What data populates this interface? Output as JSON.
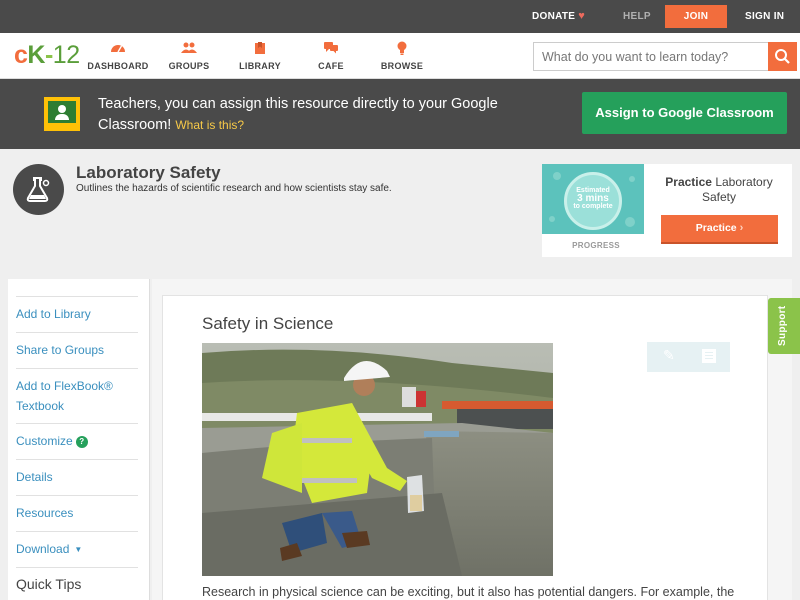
{
  "topbar": {
    "donate": "DONATE",
    "help": "HELP",
    "join": "JOIN",
    "signin": "SIGN IN"
  },
  "nav": {
    "logo_c": "c",
    "logo_k": "K",
    "logo_dash": "-",
    "logo_num": "12",
    "items": [
      {
        "label": "DASHBOARD",
        "icon": "dashboard-icon"
      },
      {
        "label": "GROUPS",
        "icon": "groups-icon"
      },
      {
        "label": "LIBRARY",
        "icon": "library-icon"
      },
      {
        "label": "CAFE",
        "icon": "cafe-icon"
      },
      {
        "label": "BROWSE",
        "icon": "browse-icon"
      }
    ],
    "search_placeholder": "What do you want to learn today?"
  },
  "banner": {
    "text": "Teachers, you can assign this resource directly to your Google Classroom!",
    "what": "What is this?",
    "button": "Assign to Google Classroom"
  },
  "header": {
    "title": "Laboratory Safety",
    "subtitle": "Outlines the hazards of scientific research and how scientists stay safe."
  },
  "practice": {
    "estimated": "Estimated",
    "mins": "3 mins",
    "to_complete": "to complete",
    "progress": "PROGRESS",
    "title_bold": "Practice",
    "title_rest": "Laboratory Safety",
    "button": "Practice"
  },
  "sidebar": {
    "items": [
      {
        "label": "Add to Library"
      },
      {
        "label": "Share to Groups"
      },
      {
        "label": "Add to FlexBook® Textbook"
      },
      {
        "label": "Customize"
      },
      {
        "label": "Details"
      },
      {
        "label": "Resources"
      },
      {
        "label": "Download"
      }
    ],
    "quick_tips": "Quick Tips"
  },
  "content": {
    "section_title": "Safety in Science",
    "body": "Research in physical science can be exciting, but it also has potential dangers. For example, the"
  },
  "support": "Support",
  "colors": {
    "accent": "#f26d3d",
    "green": "#25a05b",
    "link": "#3a8fbe",
    "dark": "#4a4a4a"
  }
}
